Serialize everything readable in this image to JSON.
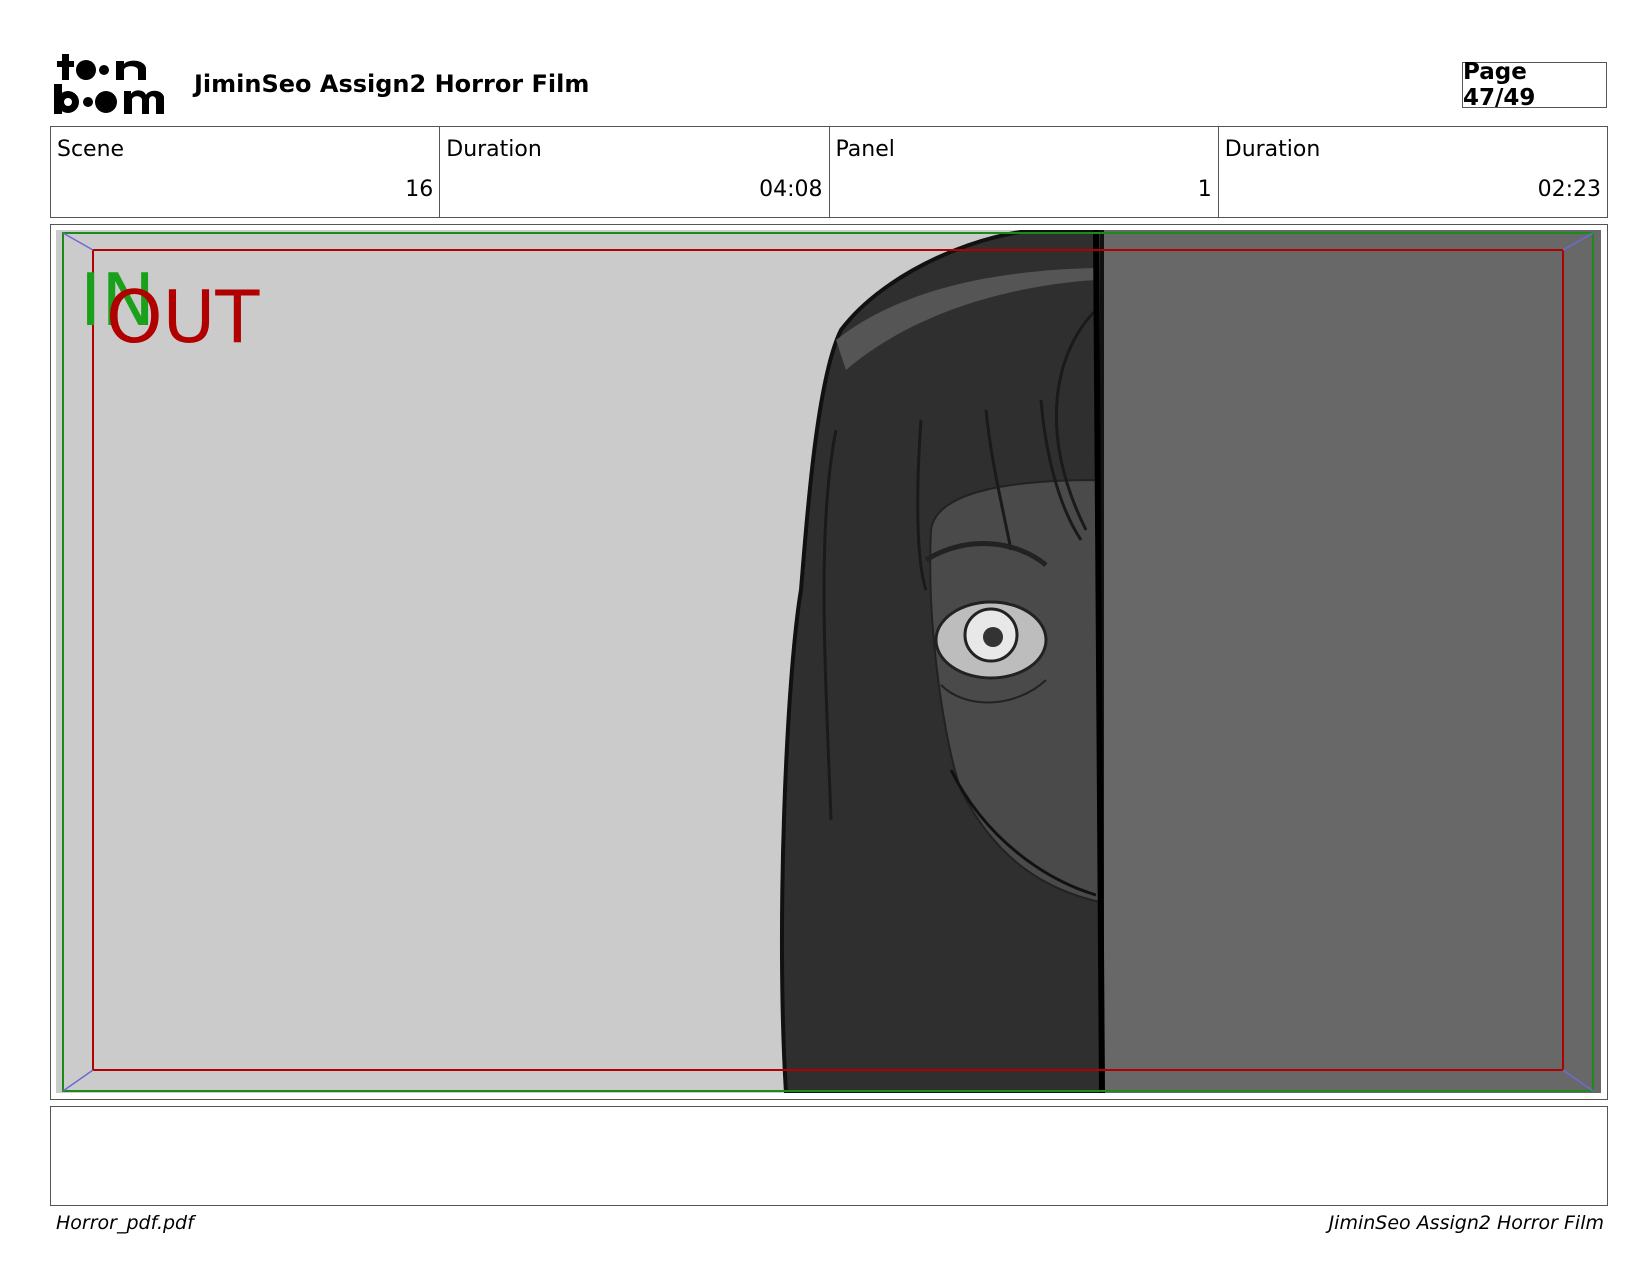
{
  "header": {
    "logo_text": "toon boom",
    "project_title": "JiminSeo Assign2 Horror Film",
    "page_label": "Page 47/49"
  },
  "info": [
    {
      "label": "Scene",
      "value": "16"
    },
    {
      "label": "Duration",
      "value": "04:08"
    },
    {
      "label": "Panel",
      "value": "1"
    },
    {
      "label": "Duration",
      "value": "02:23"
    }
  ],
  "panel": {
    "in_label": "IN",
    "out_label": "OUT",
    "colors": {
      "in_frame": "#1a8a1a",
      "out_frame": "#b00000",
      "background": "#cbcbcb",
      "door": "#686868"
    }
  },
  "notes": "",
  "footer": {
    "file_name": "Horror_pdf.pdf",
    "project_title": "JiminSeo Assign2 Horror Film"
  }
}
